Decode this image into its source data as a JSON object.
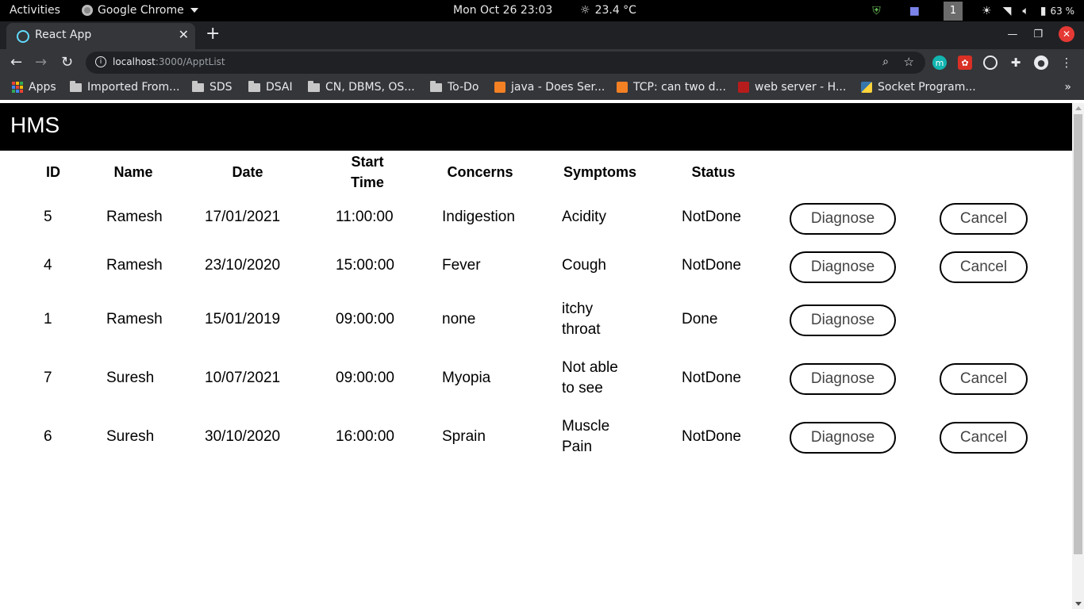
{
  "system": {
    "activities": "Activities",
    "app_name": "Google Chrome",
    "clock": "Mon Oct 26  23:03",
    "weather": "23.4 °C",
    "workspace": "1",
    "battery": "63 %"
  },
  "browser": {
    "tab_title": "React App",
    "url_host": "localhost",
    "url_path": ":3000/ApptList",
    "bookmarks": [
      "Apps",
      "Imported From...",
      "SDS",
      "DSAI",
      "CN, DBMS, OS...",
      "To-Do",
      "java - Does Ser...",
      "TCP: can two d...",
      "web server - H...",
      "Socket Program..."
    ]
  },
  "app": {
    "brand": "HMS"
  },
  "table": {
    "headers": [
      "ID",
      "Name",
      "Date",
      "Start Time",
      "Concerns",
      "Symptoms",
      "Status"
    ],
    "rows": [
      {
        "id": "5",
        "name": "Ramesh",
        "date": "17/01/2021",
        "start": "11:00:00",
        "concerns": "Indigestion",
        "symptoms": "Acidity",
        "status": "NotDone",
        "diagnose": "Diagnose",
        "cancel": "Cancel"
      },
      {
        "id": "4",
        "name": "Ramesh",
        "date": "23/10/2020",
        "start": "15:00:00",
        "concerns": "Fever",
        "symptoms": "Cough",
        "status": "NotDone",
        "diagnose": "Diagnose",
        "cancel": "Cancel"
      },
      {
        "id": "1",
        "name": "Ramesh",
        "date": "15/01/2019",
        "start": "09:00:00",
        "concerns": "none",
        "symptoms": "itchy throat",
        "status": "Done",
        "diagnose": "Diagnose"
      },
      {
        "id": "7",
        "name": "Suresh",
        "date": "10/07/2021",
        "start": "09:00:00",
        "concerns": "Myopia",
        "symptoms": "Not able to see",
        "status": "NotDone",
        "diagnose": "Diagnose",
        "cancel": "Cancel"
      },
      {
        "id": "6",
        "name": "Suresh",
        "date": "30/10/2020",
        "start": "16:00:00",
        "concerns": "Sprain",
        "symptoms": "Muscle Pain",
        "status": "NotDone",
        "diagnose": "Diagnose",
        "cancel": "Cancel"
      }
    ]
  }
}
